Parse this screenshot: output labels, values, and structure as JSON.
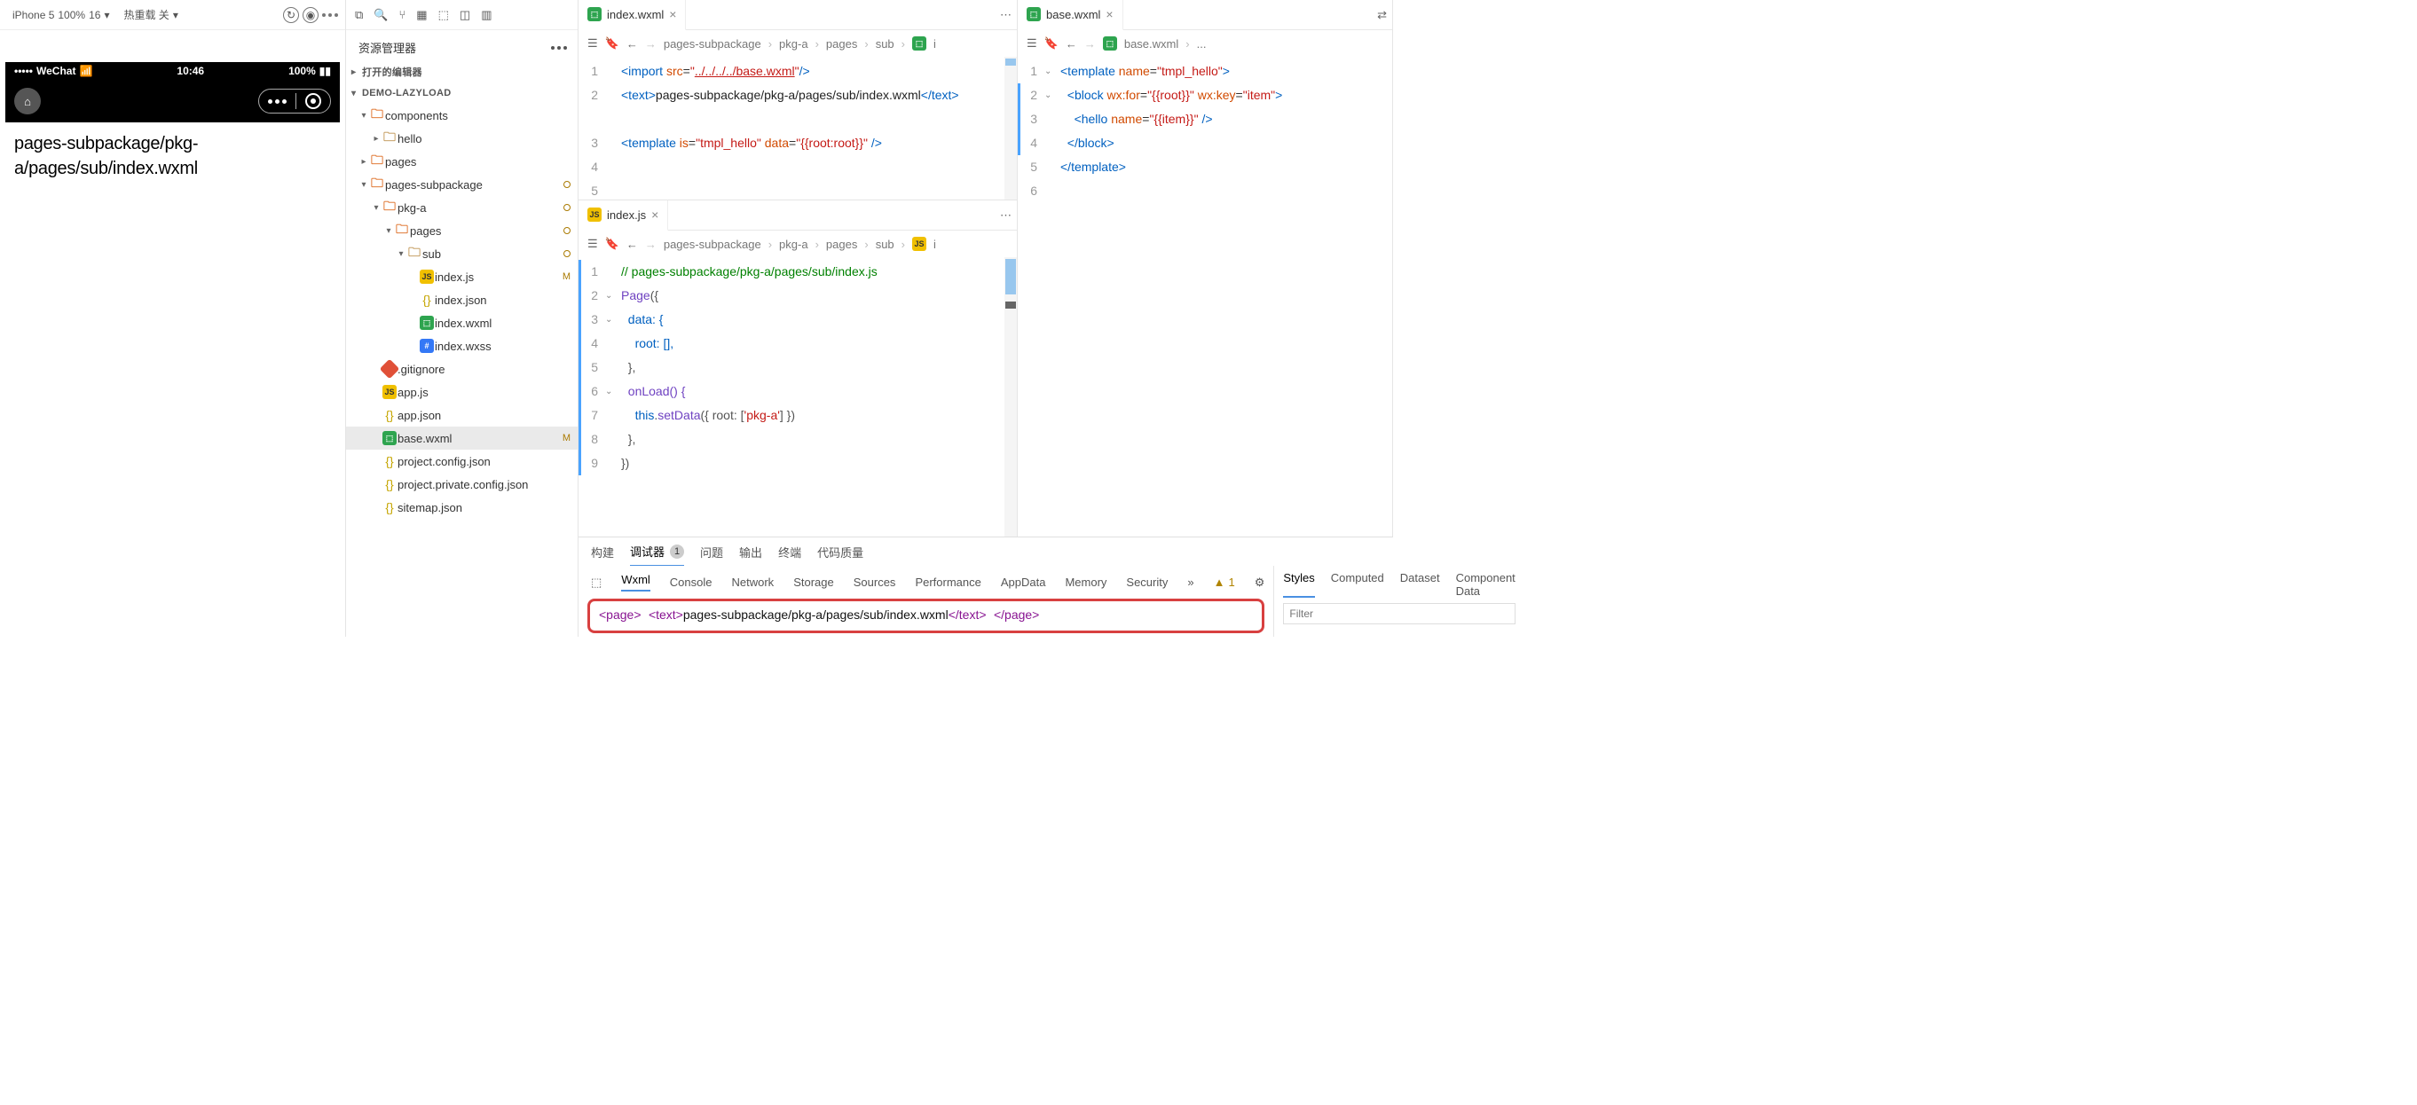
{
  "simulator": {
    "device": "iPhone 5",
    "zoom": "100%",
    "font": "16",
    "hot_reload": "热重载 关",
    "status": {
      "carrier": "WeChat",
      "time": "10:46",
      "battery": "100%"
    },
    "page_text": "pages-subpackage/pkg-a/pages/sub/index.wxml"
  },
  "explorer": {
    "title": "资源管理器",
    "opened_editors": "打开的编辑器",
    "project": "DEMO-LAZYLOAD",
    "tree": {
      "components": "components",
      "hello": "hello",
      "pages": "pages",
      "pages_subpackage": "pages-subpackage",
      "pkg_a": "pkg-a",
      "pages2": "pages",
      "sub": "sub",
      "index_js": "index.js",
      "index_json": "index.json",
      "index_wxml": "index.wxml",
      "index_wxss": "index.wxss",
      "gitignore": ".gitignore",
      "app_js": "app.js",
      "app_json": "app.json",
      "base_wxml": "base.wxml",
      "project_config": "project.config.json",
      "project_private": "project.private.config.json",
      "sitemap": "sitemap.json"
    },
    "m_badge": "M"
  },
  "tabs": {
    "index_wxml": "index.wxml",
    "index_js": "index.js",
    "base_wxml": "base.wxml"
  },
  "crumbs": {
    "c1": [
      "pages-subpackage",
      "pkg-a",
      "pages",
      "sub"
    ],
    "c1_tail": "i",
    "c2": [
      "pages-subpackage",
      "pkg-a",
      "pages",
      "sub"
    ],
    "c2_tail": "i",
    "c3": "base.wxml",
    "c3_tail": "..."
  },
  "editor_index_wxml": {
    "l1a": "<import",
    "l1b": "src",
    "l1c": "../../../../base.wxml",
    "l1d": "/>",
    "l2a": "<text>",
    "l2b": "pages-subpackage/pkg-a/pages/sub/index.wxml",
    "l2c": "</text>",
    "l4a": "<template",
    "l4b": "is",
    "l4c": "tmpl_hello",
    "l4d": "data",
    "l4e": "{{root:root}}",
    "l4f": "/>"
  },
  "editor_index_js": {
    "l1": "// pages-subpackage/pkg-a/pages/sub/index.js",
    "l2a": "Page",
    "l2b": "({",
    "l3": "data: {",
    "l4": "root: [],",
    "l5": "},",
    "l6": "onLoad() {",
    "l7a": "this",
    "l7b": ".",
    "l7c": "setData",
    "l7d": "({ root: [",
    "l7e": "'pkg-a'",
    "l7f": "] })",
    "l8": "},",
    "l9": "})"
  },
  "editor_base_wxml": {
    "l1a": "<template",
    "l1b": "name",
    "l1c": "tmpl_hello",
    "l1d": ">",
    "l2a": "<block",
    "l2b": "wx:for",
    "l2c": "{{root}}",
    "l2d": "wx:key",
    "l2e": "item",
    "l2f": ">",
    "l3a": "<hello",
    "l3b": "name",
    "l3c": "{{item}}",
    "l3d": "/>",
    "l4": "</block>",
    "l5": "</template>"
  },
  "panel": {
    "build": "构建",
    "debug": "调试器",
    "debug_badge": "1",
    "problems": "问题",
    "output": "输出",
    "terminal": "终端",
    "quality": "代码质量"
  },
  "devtools": {
    "tabs": [
      "Wxml",
      "Console",
      "Network",
      "Storage",
      "Sources",
      "Performance",
      "AppData",
      "Memory",
      "Security"
    ],
    "warn_count": "1",
    "dom_l1": "<page>",
    "dom_l2a": "<text>",
    "dom_l2b": "pages-subpackage/pkg-a/pages/sub/index.wxml",
    "dom_l2c": "</text>",
    "dom_l3": "</page>",
    "side_tabs": [
      "Styles",
      "Computed",
      "Dataset",
      "Component Data"
    ],
    "filter_ph": "Filter"
  }
}
